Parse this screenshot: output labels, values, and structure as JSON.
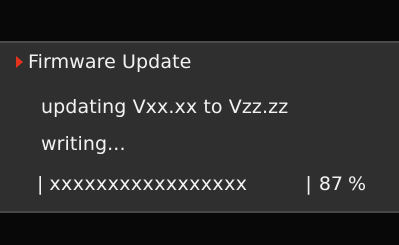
{
  "dialog": {
    "title": "Firmware Update",
    "accent_color": "#e2331c",
    "status_text": "updating  Vxx.xx to Vzz.zz",
    "phase_text": "writing...",
    "progress": {
      "fill_text": "xxxxxxxxxxxxxxxxx",
      "value": 87,
      "unit": "%",
      "left_divider": "|",
      "right_divider": "|"
    }
  }
}
